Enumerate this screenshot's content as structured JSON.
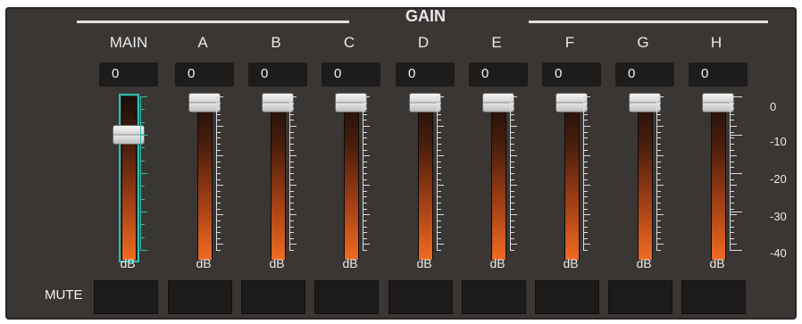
{
  "header": {
    "title": "GAIN"
  },
  "channels": [
    {
      "label": "MAIN",
      "value": "0",
      "unit": "dB",
      "level": 0.78
    },
    {
      "label": "A",
      "value": "0",
      "unit": "dB",
      "level": 1.0
    },
    {
      "label": "B",
      "value": "0",
      "unit": "dB",
      "level": 1.0
    },
    {
      "label": "C",
      "value": "0",
      "unit": "dB",
      "level": 1.0
    },
    {
      "label": "D",
      "value": "0",
      "unit": "dB",
      "level": 1.0
    },
    {
      "label": "E",
      "value": "0",
      "unit": "dB",
      "level": 1.0
    },
    {
      "label": "F",
      "value": "0",
      "unit": "dB",
      "level": 1.0
    },
    {
      "label": "G",
      "value": "0",
      "unit": "dB",
      "level": 1.0
    },
    {
      "label": "H",
      "value": "0",
      "unit": "dB",
      "level": 1.0
    }
  ],
  "scale_labels": [
    "0",
    "-10",
    "-20",
    "-30",
    "-40"
  ],
  "mute": {
    "label": "MUTE"
  },
  "colors": {
    "panel": "#3a3634",
    "main_accent": "#2bbfb0",
    "fader_bottom": "#f06b22",
    "fader_top": "#1a0f0b"
  }
}
